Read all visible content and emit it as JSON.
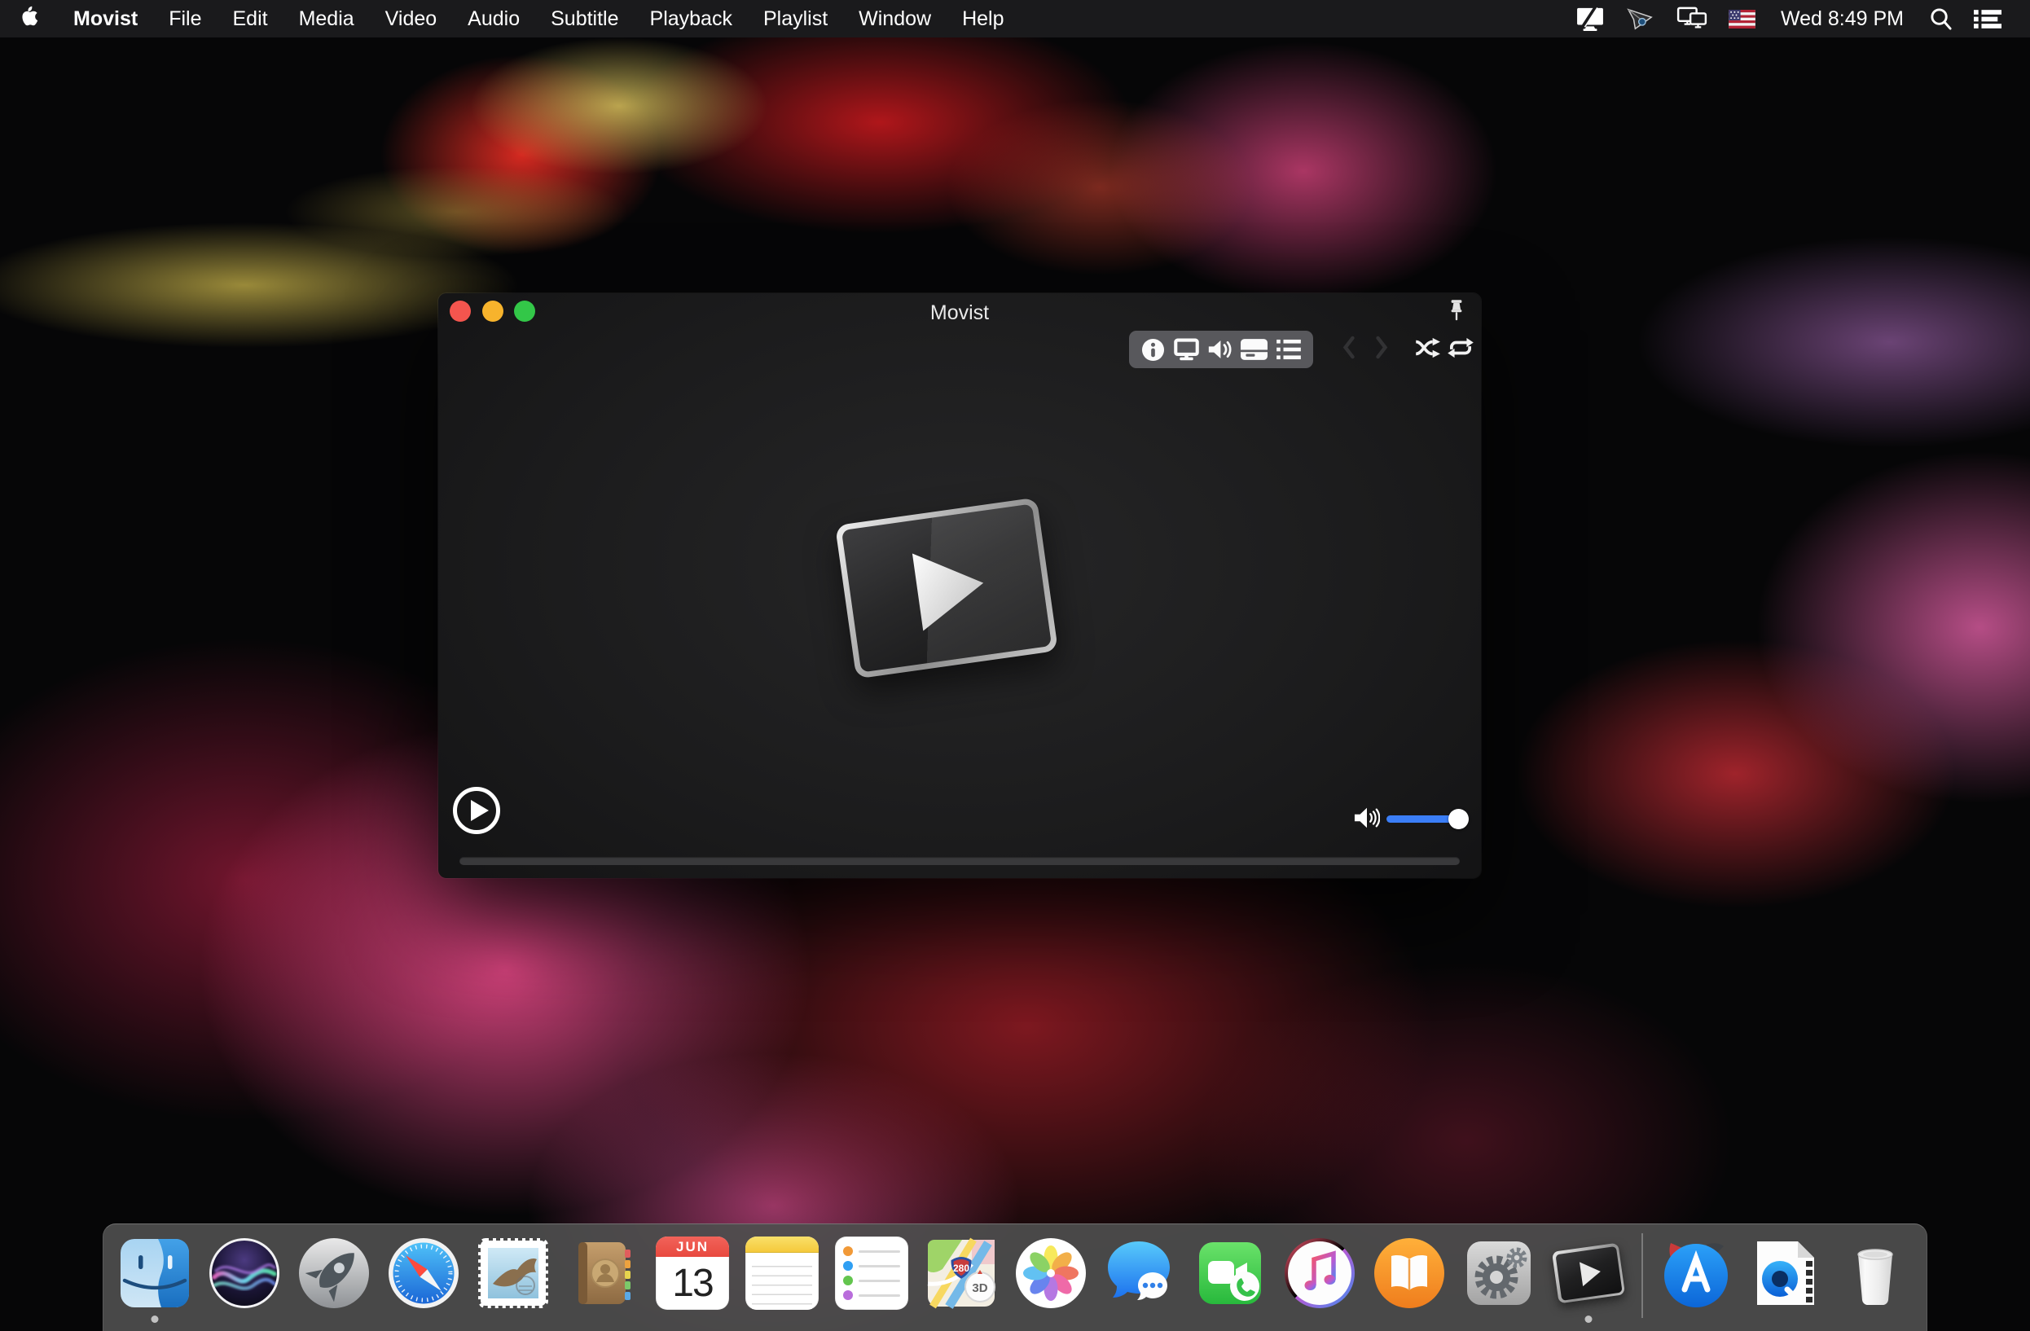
{
  "menu_bar": {
    "app_name": "Movist",
    "menus": [
      "File",
      "Edit",
      "Media",
      "Video",
      "Audio",
      "Subtitle",
      "Playback",
      "Playlist",
      "Window",
      "Help"
    ],
    "clock": "Wed 8:49 PM",
    "status_icons": [
      "display-slash-icon",
      "paper-plane-icon",
      "screen-mirroring-icon",
      "us-flag-icon",
      "spotlight-icon",
      "notification-center-icon"
    ]
  },
  "window": {
    "title": "Movist",
    "toolbar_icons": [
      "media-info",
      "video-settings",
      "audio-volume",
      "subtitle",
      "playlist"
    ],
    "nav_icons": [
      "previous",
      "next",
      "shuffle",
      "repeat"
    ],
    "volume": {
      "percent": 100,
      "accent": "#3b7ef7"
    },
    "seekbar_progress": 0
  },
  "dock": {
    "items": [
      "finder",
      "siri",
      "launchpad",
      "safari",
      "mail",
      "contacts",
      "calendar",
      "notes",
      "reminders",
      "maps",
      "photos",
      "messages",
      "facetime",
      "itunes",
      "ibooks",
      "system-preferences",
      "movist",
      "app-store",
      "quicktime",
      "trash"
    ],
    "running": [
      "finder",
      "movist"
    ],
    "calendar_month": "JUN",
    "calendar_day": "13",
    "maps_shield": "280",
    "maps_badge": "3D"
  },
  "colors": {
    "traffic_red": "#f4554e",
    "traffic_yellow": "#f7b32c",
    "traffic_green": "#33c748",
    "accent_blue": "#3b7ef7",
    "menubar_bg": "#1b1b1d",
    "dock_bg": "#4d4d4e"
  }
}
